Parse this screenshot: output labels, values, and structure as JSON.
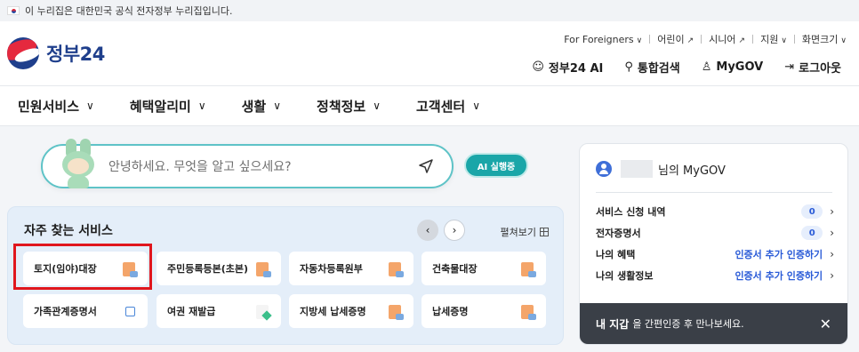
{
  "banner": {
    "text": "이 누리집은 대한민국 공식 전자정부 누리집입니다."
  },
  "logo": {
    "text": "정부24"
  },
  "util": {
    "links": [
      "For Foreigners",
      "어린이",
      "시니어",
      "지원",
      "화면크기"
    ]
  },
  "actions": {
    "ai": "정부24 AI",
    "search": "통합검색",
    "mygov": "MyGOV",
    "logout": "로그아웃"
  },
  "gnb": [
    "민원서비스",
    "혜택알리미",
    "생활",
    "정책정보",
    "고객센터"
  ],
  "search": {
    "placeholder": "안녕하세요. 무엇을 알고 싶으세요?"
  },
  "ai_button": "AI 실행중",
  "favorites": {
    "title": "자주 찾는 서비스",
    "expand": "펼쳐보기",
    "items": [
      "토지(임야)대장",
      "주민등록등본(초본)",
      "자동차등록원부",
      "건축물대장",
      "가족관계증명서",
      "여권 재발급",
      "지방세 납세증명",
      "납세증명"
    ]
  },
  "mygov": {
    "title_suffix": "님의 MyGOV",
    "rows": [
      {
        "label": "서비스 신청 내역",
        "value": "0"
      },
      {
        "label": "전자증명서",
        "value": "0"
      },
      {
        "label": "나의 혜택",
        "value": "인증서 추가 인증하기"
      },
      {
        "label": "나의 생활정보",
        "value": "인증서 추가 인증하기"
      }
    ],
    "wallet_bold": "내 지갑",
    "wallet_text": "을 간편인증 후 만나보세요."
  },
  "colors": {
    "brand": "#1f3f8c",
    "accent": "#1aa6a8",
    "highlight": "#e0161d",
    "link": "#2a5bd7"
  }
}
